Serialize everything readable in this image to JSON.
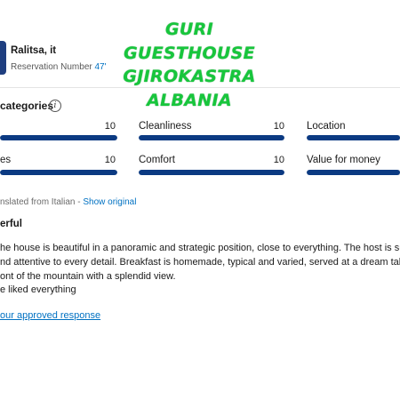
{
  "reviewer": {
    "name": "Ralitsa, it",
    "reservation_label": "Reservation Number",
    "reservation_number": "47'"
  },
  "watermark": {
    "lines": [
      "GURI",
      "GUESTHOUSE",
      "GJIROKASTRA",
      "ALBANIA"
    ],
    "color": "#17c63c"
  },
  "categories": {
    "title": "categories",
    "info_icon": "info-icon",
    "items": [
      {
        "label": "",
        "score": "10",
        "value": 1.0
      },
      {
        "label": "Cleanliness",
        "score": "10",
        "value": 1.0
      },
      {
        "label": "Location",
        "score": "",
        "value": 1.0
      },
      {
        "label": "es",
        "score": "10",
        "value": 1.0
      },
      {
        "label": "Comfort",
        "score": "10",
        "value": 1.0
      },
      {
        "label": "Value for money",
        "score": "",
        "value": 1.0
      }
    ],
    "bar_color": "#0b3a82"
  },
  "review": {
    "translated_prefix": "nslated from Italian - ",
    "show_original": "Show original",
    "title": "erful",
    "body_lines": [
      "he house is beautiful in a panoramic and strategic position, close to everything. The host is su",
      "nd attentive to every detail. Breakfast is homemade, typical and varied, served at a dream tab",
      "ont of the mountain with a splendid view.",
      "e liked everything"
    ],
    "response_link": "our approved response"
  },
  "colors": {
    "link": "#0071c2",
    "avatar": "#1f3f80"
  }
}
